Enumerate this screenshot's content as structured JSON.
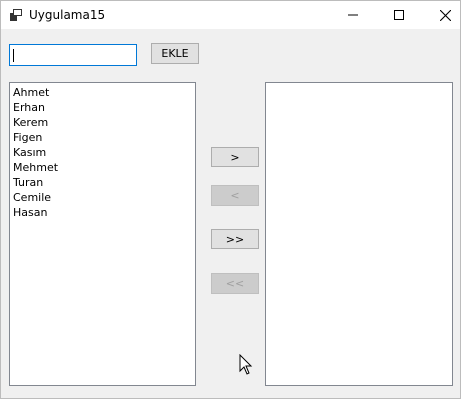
{
  "window": {
    "title": "Uygulama15",
    "controls": {
      "minimize": "minimize-icon",
      "maximize": "maximize-icon",
      "close": "close-icon"
    }
  },
  "form": {
    "input_value": "",
    "add_button_label": "EKLE",
    "left_list": [
      "Ahmet",
      "Erhan",
      "Kerem",
      "Figen",
      "Kasım",
      "Mehmet",
      "Turan",
      "Cemile",
      "Hasan"
    ],
    "right_list": [],
    "move_right_label": ">",
    "move_left_label": "<",
    "move_all_right_label": ">>",
    "move_all_left_label": "<<"
  },
  "colors": {
    "focus_border": "#0078d7",
    "button_bg": "#e1e1e1",
    "button_disabled_bg": "#cccccc",
    "window_bg": "#f0f0f0"
  }
}
